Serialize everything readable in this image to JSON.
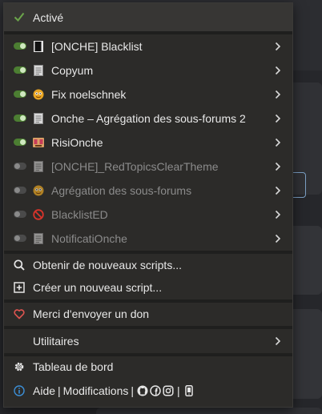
{
  "menu": {
    "active_label": "Activé",
    "scripts": [
      {
        "name": "[ONCHE] Blacklist",
        "enabled": true,
        "icon": "black-book-icon"
      },
      {
        "name": "Copyum",
        "enabled": true,
        "icon": "document-icon"
      },
      {
        "name": "Fix noelschnek",
        "enabled": true,
        "icon": "smiley-icon"
      },
      {
        "name": "Onche – Agrégation des sous-forums 2",
        "enabled": true,
        "icon": "document-icon"
      },
      {
        "name": "RisiOnche",
        "enabled": true,
        "icon": "risitas-icon"
      },
      {
        "name": "[ONCHE]_RedTopicsClearTheme",
        "enabled": false,
        "icon": "document-icon"
      },
      {
        "name": "Agrégation des sous-forums",
        "enabled": false,
        "icon": "smiley-icon"
      },
      {
        "name": "BlacklistED",
        "enabled": false,
        "icon": "forbidden-icon"
      },
      {
        "name": "NotificatiOnche",
        "enabled": false,
        "icon": "document-icon"
      }
    ],
    "get_scripts_label": "Obtenir de nouveaux scripts...",
    "create_script_label": "Créer un nouveau script...",
    "donate_label": "Merci d'envoyer un don",
    "utilities_label": "Utilitaires",
    "dashboard_label": "Tableau de bord",
    "help_label": "Aide",
    "changes_label": "Modifications",
    "separator": "|"
  },
  "colors": {
    "menu_bg": "#2c2b29",
    "toggle_on": "#4c7e32",
    "check": "#6ba54a",
    "heart": "#d9534f",
    "info": "#3c8fd6",
    "disabled_text": "#8b8b8b"
  }
}
